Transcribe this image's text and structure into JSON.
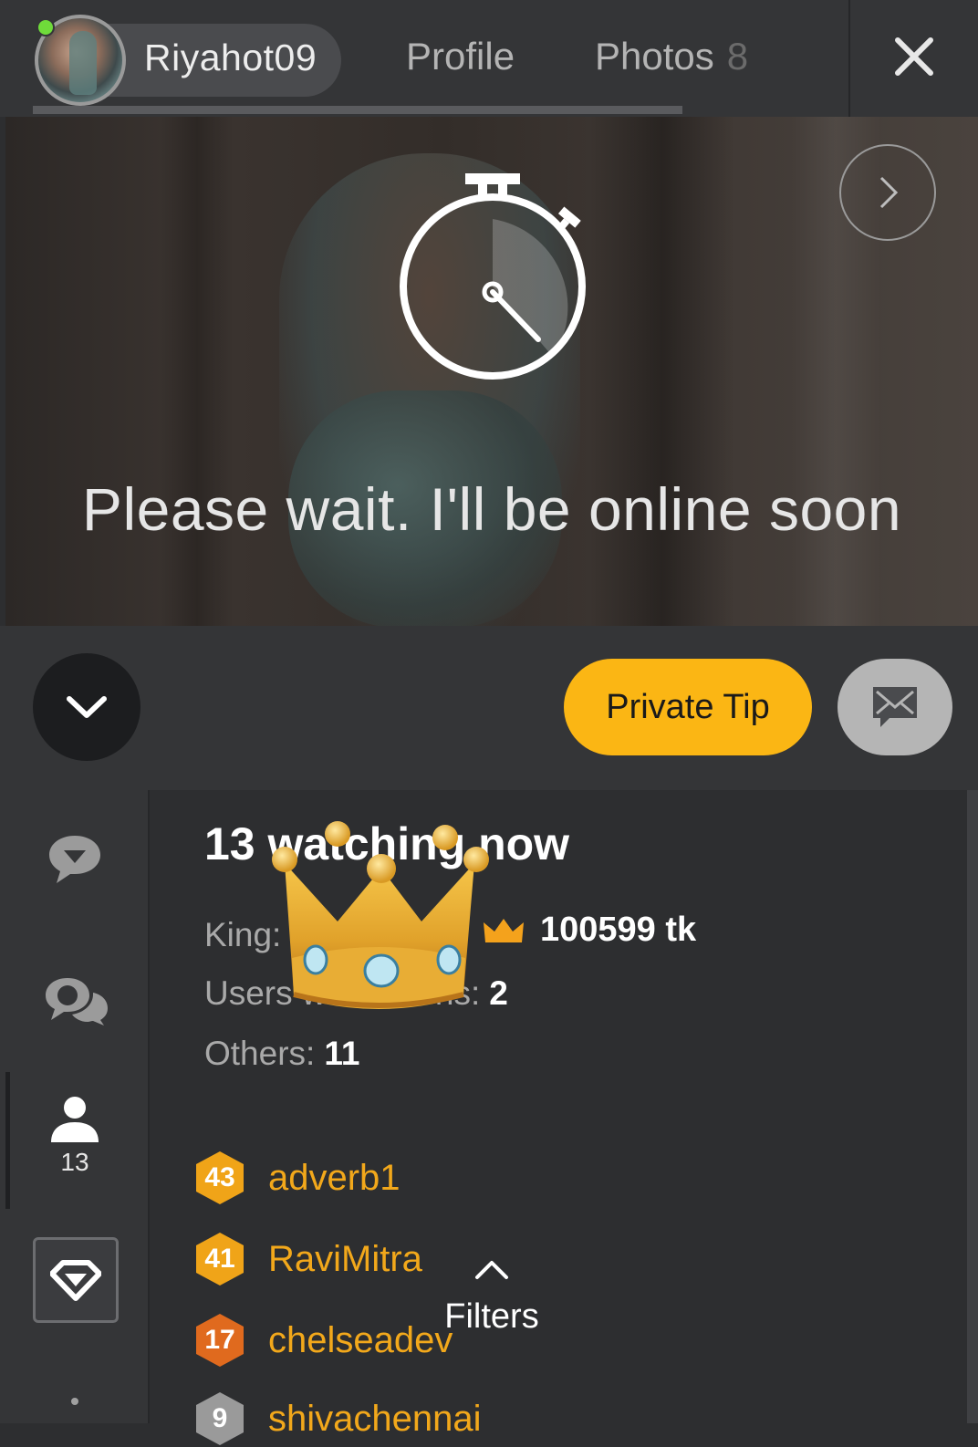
{
  "header": {
    "username": "Riyahot09",
    "tabs": [
      {
        "label": "Profile"
      },
      {
        "label": "Photos",
        "count": "8"
      }
    ]
  },
  "video": {
    "status_message": "Please wait. I'll be online soon"
  },
  "actions": {
    "private_tip_label": "Private Tip"
  },
  "sidebar": {
    "users_count": "13"
  },
  "viewers": {
    "title": "13 watching now",
    "king_label": "King:",
    "king_amount": "100599 tk",
    "users_with_tokens_label": "Users with tokens:",
    "users_with_tokens_value": "2",
    "others_label": "Others:",
    "others_value": "11",
    "list": [
      {
        "level": "43",
        "name": "adverb1",
        "badge_color": "#f0a418"
      },
      {
        "level": "41",
        "name": "RaviMitra",
        "badge_color": "#f0a418"
      },
      {
        "level": "17",
        "name": "chelseadev",
        "badge_color": "#e06a1e"
      },
      {
        "level": "9",
        "name": "shivachennai",
        "badge_color": "#9a9a9a"
      }
    ],
    "filters_label": "Filters"
  },
  "colors": {
    "accent": "#fbb614",
    "username": "#f2a81b",
    "background": "#2d2e30",
    "bar": "#343537",
    "online": "#6fdb3a"
  }
}
